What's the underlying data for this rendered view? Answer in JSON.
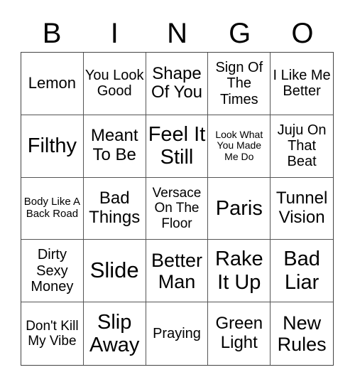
{
  "header": [
    "B",
    "I",
    "N",
    "G",
    "O"
  ],
  "cells": [
    "Lemon",
    "You Look Good",
    "Shape Of You",
    "Sign Of The Times",
    "I Like Me Better",
    "Filthy",
    "Meant To Be",
    "Feel It Still",
    "Look What You Made Me Do",
    "Juju On That Beat",
    "Body Like A Back Road",
    "Bad Things",
    "Versace On The Floor",
    "Paris",
    "Tunnel Vision",
    "Dirty Sexy Money",
    "Slide",
    "Better Man",
    "Rake It Up",
    "Bad Liar",
    "Don't Kill My Vibe",
    "Slip Away",
    "Praying",
    "Green Light",
    "New Rules"
  ]
}
